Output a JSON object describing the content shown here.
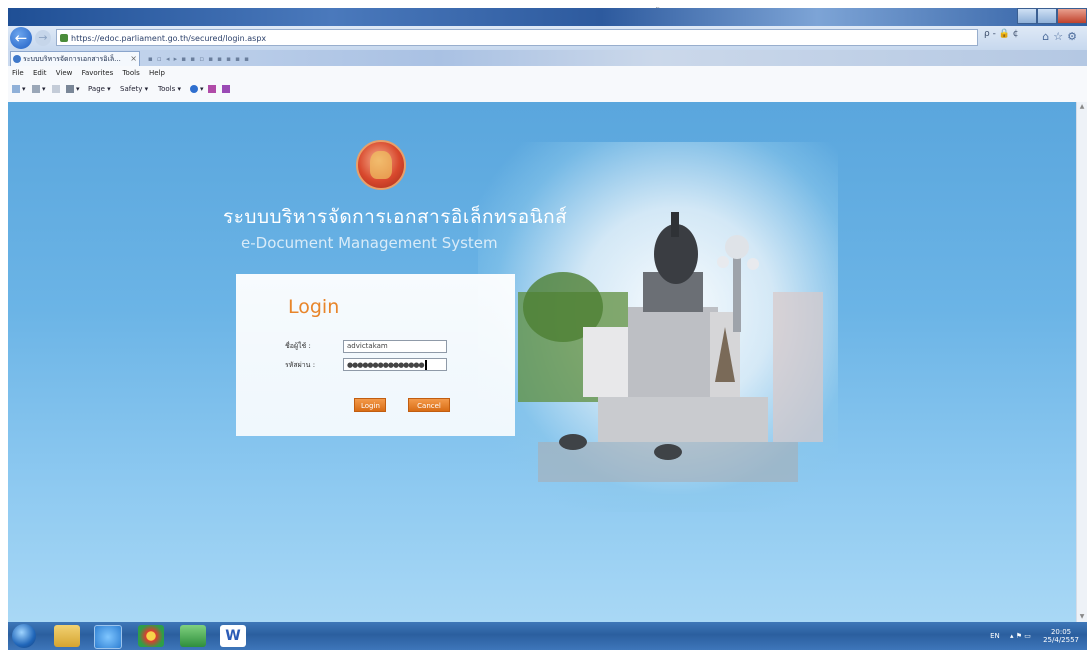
{
  "caption": "ู",
  "browser": {
    "url": "https://edoc.parliament.go.th/secured/login.aspx",
    "tab_title": "ระบบบริหารจัดการเอกสารอิเล็...",
    "search_label": "ρ - 🔒 ¢",
    "menu": [
      "File",
      "Edit",
      "View",
      "Favorites",
      "Tools",
      "Help"
    ],
    "commands": [
      "Page ▾",
      "Safety ▾",
      "Tools ▾"
    ]
  },
  "page": {
    "title_thai": "ระบบบริหารจัดการเอกสารอิเล็กทรอนิกส์",
    "title_english": "e-Document Management System"
  },
  "login": {
    "heading": "Login",
    "username_label": "ชื่อผู้ใช้ :",
    "username_value": "advictakam",
    "password_label": "รหัสผ่าน :",
    "password_value": "●●●●●●●●●●●●●●●",
    "login_button": "Login",
    "cancel_button": "Cancel"
  },
  "taskbar": {
    "language": "EN",
    "time": "20:05",
    "date": "25/4/2557"
  },
  "colors": {
    "page_bg": "#6bb4e6",
    "accent_orange": "#e8852a",
    "taskbar": "#2b5f9f"
  }
}
